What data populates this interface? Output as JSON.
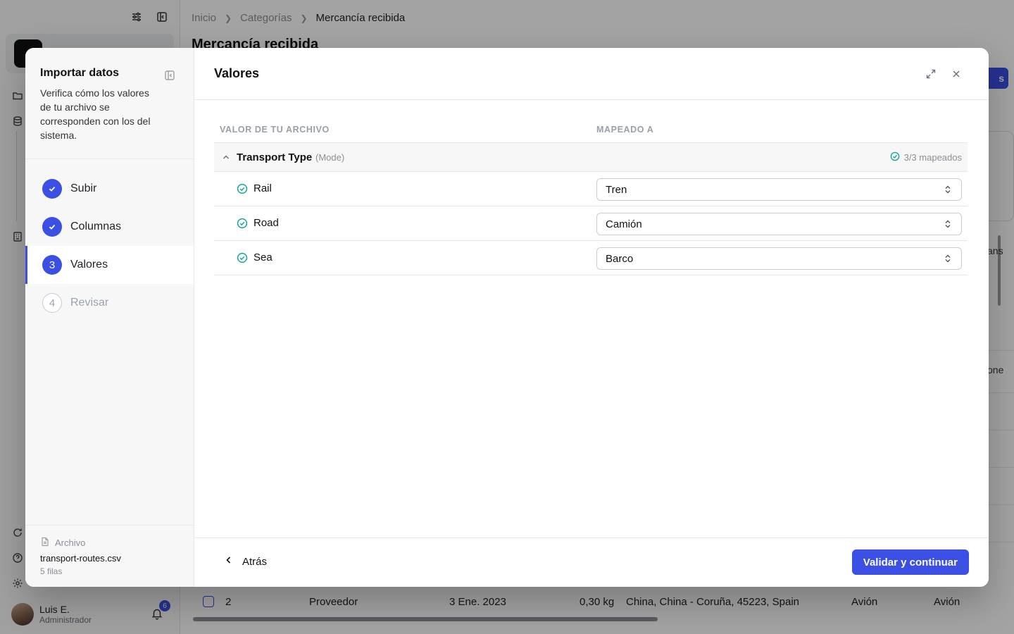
{
  "background": {
    "breadcrumb": {
      "items": [
        "Inicio",
        "Categorías",
        "Mercancía recibida"
      ]
    },
    "page_title": "Mercancía recibida",
    "action_button_fragment": "s",
    "edge_fragments": [
      "ans",
      "one"
    ],
    "user": {
      "name": "Luis E.",
      "role": "Administrador"
    },
    "notifications_count": "6",
    "table_row": {
      "index": "2",
      "type": "Proveedor",
      "date": "3 Ene. 2023",
      "weight": "0,30 kg",
      "route": "China, China - Coruña, 45223, Spain",
      "mode_a": "Avión",
      "mode_b": "Avión"
    }
  },
  "wizard": {
    "title": "Importar datos",
    "description": "Verifica cómo los valores de tu archivo se corresponden con los del sistema.",
    "steps": [
      {
        "number": "1",
        "label": "Subir",
        "state": "done"
      },
      {
        "number": "2",
        "label": "Columnas",
        "state": "done"
      },
      {
        "number": "3",
        "label": "Valores",
        "state": "active"
      },
      {
        "number": "4",
        "label": "Revisar",
        "state": "pending"
      }
    ],
    "file": {
      "label": "Archivo",
      "name": "transport-routes.csv",
      "rows": "5 filas"
    }
  },
  "main": {
    "title": "Valores",
    "columns": {
      "source": "VALOR DE TU ARCHIVO",
      "target": "MAPEADO A"
    },
    "group": {
      "name": "Transport Type",
      "field": "(Mode)",
      "status": "3/3 mapeados"
    },
    "rows": [
      {
        "source": "Rail",
        "target": "Tren"
      },
      {
        "source": "Road",
        "target": "Camión"
      },
      {
        "source": "Sea",
        "target": "Barco"
      }
    ],
    "footer": {
      "back_label": "Atrás",
      "continue_label": "Validar y continuar"
    }
  },
  "colors": {
    "accent": "#3b4fe4",
    "success": "#14a89a",
    "overlay": "rgba(0,0,0,0.36)"
  }
}
